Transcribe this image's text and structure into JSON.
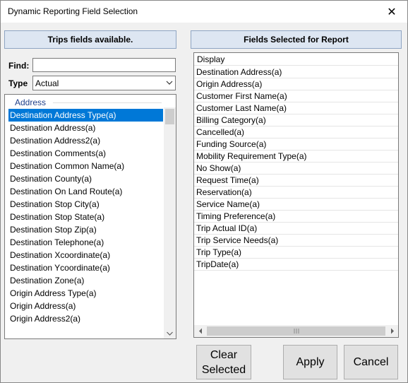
{
  "window": {
    "title": "Dynamic Reporting Field Selection",
    "close_glyph": "✕"
  },
  "left_panel": {
    "header": "Trips fields available.",
    "find_label": "Find:",
    "find_value": "",
    "type_label": "Type",
    "type_value": "Actual",
    "group_label": "Address",
    "items": [
      "Destination Address Type(a)",
      "Destination Address(a)",
      "Destination Address2(a)",
      "Destination Comments(a)",
      "Destination Common Name(a)",
      "Destination County(a)",
      "Destination On Land Route(a)",
      "Destination Stop City(a)",
      "Destination Stop State(a)",
      "Destination Stop Zip(a)",
      "Destination Telephone(a)",
      "Destination Xcoordinate(a)",
      "Destination Ycoordinate(a)",
      "Destination Zone(a)",
      "Origin Address Type(a)",
      "Origin Address(a)",
      "Origin Address2(a)"
    ],
    "selected_index": 0
  },
  "right_panel": {
    "header": "Fields Selected for Report",
    "column_header": "Display",
    "rows": [
      "Destination Address(a)",
      "Origin Address(a)",
      "Customer First Name(a)",
      "Customer Last Name(a)",
      "Billing Category(a)",
      "Cancelled(a)",
      "Funding Source(a)",
      "Mobility Requirement Type(a)",
      "No Show(a)",
      "Request Time(a)",
      "Reservation(a)",
      "Service Name(a)",
      "Timing Preference(a)",
      "Trip Actual ID(a)",
      "Trip Service Needs(a)",
      "Trip Type(a)",
      "TripDate(a)"
    ]
  },
  "buttons": {
    "clear_line1": "Clear",
    "clear_line2": "Selected",
    "apply": "Apply",
    "cancel": "Cancel"
  },
  "colors": {
    "selection": "#0078d7",
    "group_header": "#1f3f8a",
    "panel_header_bg": "#dde6f2"
  }
}
